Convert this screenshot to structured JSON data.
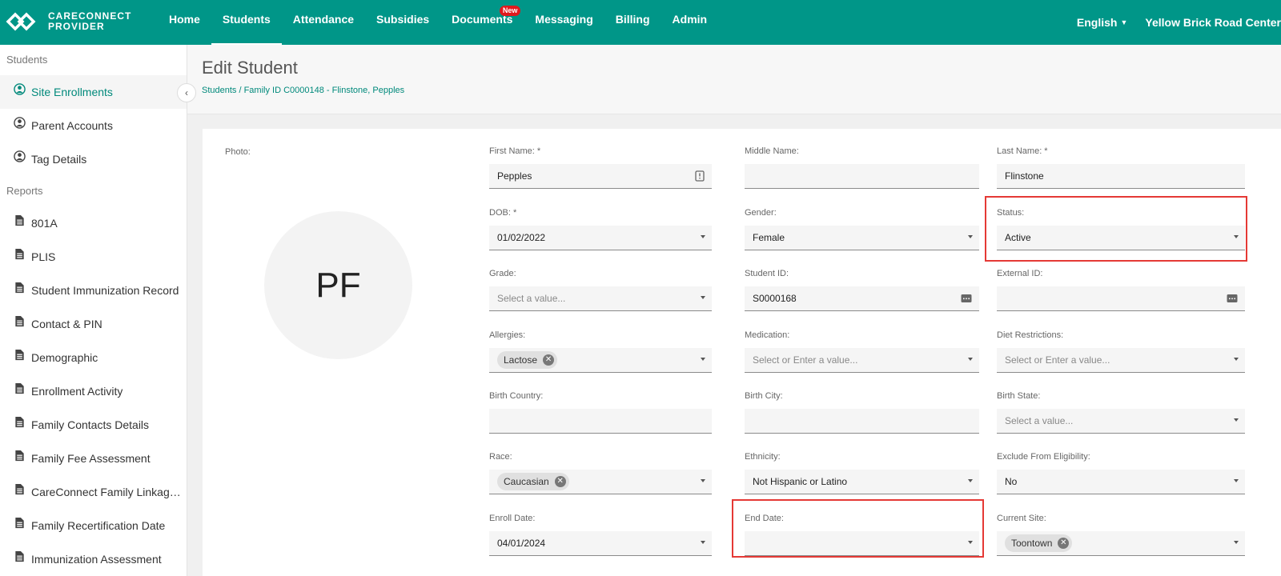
{
  "app": {
    "brand_line1": "CARECONNECT",
    "brand_line2": "PROVIDER"
  },
  "nav": [
    {
      "label": "Home",
      "active": false
    },
    {
      "label": "Students",
      "active": true
    },
    {
      "label": "Attendance",
      "active": false
    },
    {
      "label": "Subsidies",
      "active": false
    },
    {
      "label": "Documents",
      "active": false,
      "badge": "New"
    },
    {
      "label": "Messaging",
      "active": false
    },
    {
      "label": "Billing",
      "active": false
    },
    {
      "label": "Admin",
      "active": false
    }
  ],
  "top_right": {
    "language": "English",
    "center": "Yellow Brick Road Center"
  },
  "sidebar": {
    "students_heading": "Students",
    "students_items": [
      {
        "label": "Site Enrollments",
        "icon": "person-circle-icon",
        "active": true
      },
      {
        "label": "Parent Accounts",
        "icon": "person-circle-icon",
        "active": false
      },
      {
        "label": "Tag Details",
        "icon": "person-circle-icon",
        "active": false
      }
    ],
    "reports_heading": "Reports",
    "reports_items": [
      {
        "label": "801A",
        "icon": "document-icon"
      },
      {
        "label": "PLIS",
        "icon": "document-icon"
      },
      {
        "label": "Student Immunization Record",
        "icon": "document-icon"
      },
      {
        "label": "Contact & PIN",
        "icon": "document-icon"
      },
      {
        "label": "Demographic",
        "icon": "document-icon"
      },
      {
        "label": "Enrollment Activity",
        "icon": "document-icon"
      },
      {
        "label": "Family Contacts Details",
        "icon": "document-icon"
      },
      {
        "label": "Family Fee Assessment",
        "icon": "document-icon"
      },
      {
        "label": "CareConnect Family Linkage …",
        "icon": "document-icon"
      },
      {
        "label": "Family Recertification Date",
        "icon": "document-icon"
      },
      {
        "label": "Immunization Assessment",
        "icon": "document-icon"
      }
    ]
  },
  "page": {
    "title": "Edit Student",
    "breadcrumb": "Students / Family ID C0000148 - Flinstone, Pepples",
    "photo_label": "Photo:",
    "initials": "PF"
  },
  "form": {
    "first_name": {
      "label": "First Name: *",
      "value": "Pepples"
    },
    "middle_name": {
      "label": "Middle Name:",
      "value": ""
    },
    "last_name": {
      "label": "Last Name: *",
      "value": "Flinstone"
    },
    "dob": {
      "label": "DOB: *",
      "value": "01/02/2022"
    },
    "gender": {
      "label": "Gender:",
      "value": "Female"
    },
    "status": {
      "label": "Status:",
      "value": "Active"
    },
    "grade": {
      "label": "Grade:",
      "placeholder": "Select a value..."
    },
    "student_id": {
      "label": "Student ID:",
      "value": "S0000168"
    },
    "external_id": {
      "label": "External ID:",
      "value": ""
    },
    "allergies": {
      "label": "Allergies:",
      "chip": "Lactose"
    },
    "medication": {
      "label": "Medication:",
      "placeholder": "Select or Enter a value..."
    },
    "diet": {
      "label": "Diet Restrictions:",
      "placeholder": "Select or Enter a value..."
    },
    "birth_country": {
      "label": "Birth Country:",
      "value": ""
    },
    "birth_city": {
      "label": "Birth City:",
      "value": ""
    },
    "birth_state": {
      "label": "Birth State:",
      "placeholder": "Select a value..."
    },
    "race": {
      "label": "Race:",
      "chip": "Caucasian"
    },
    "ethnicity": {
      "label": "Ethnicity:",
      "value": "Not Hispanic or Latino"
    },
    "exclude": {
      "label": "Exclude From Eligibility:",
      "value": "No"
    },
    "enroll_date": {
      "label": "Enroll Date:",
      "value": "04/01/2024"
    },
    "end_date": {
      "label": "End Date:",
      "value": ""
    },
    "current_site": {
      "label": "Current Site:",
      "chip": "Toontown"
    }
  },
  "colors": {
    "primary": "#009688",
    "accent_text": "#00897b",
    "highlight": "#e53935",
    "badge": "#e0191e"
  }
}
